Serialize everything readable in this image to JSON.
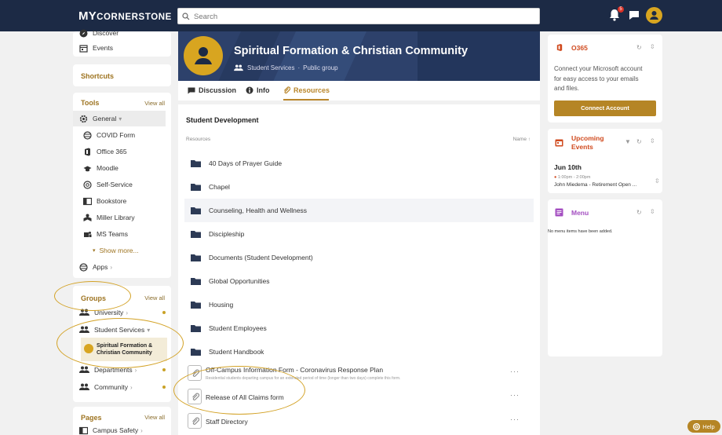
{
  "app": {
    "logo_prefix": "MY",
    "logo_main": "CORNERSTONE",
    "search_placeholder": "Search",
    "notification_count": "5"
  },
  "sidebar": {
    "discover": "Discover",
    "events": "Events",
    "shortcuts": "Shortcuts",
    "tools": {
      "title": "Tools",
      "view_all": "View all",
      "general": "General",
      "items": [
        "COVID Form",
        "Office 365",
        "Moodle",
        "Self-Service",
        "Bookstore",
        "Miller Library",
        "MS Teams"
      ],
      "show_more": "Show more...",
      "apps": "Apps"
    },
    "groups": {
      "title": "Groups",
      "view_all": "View all",
      "university": "University",
      "student_services": "Student Services",
      "active_group": [
        "Spiritual Formation &",
        "Christian Community"
      ],
      "departments": "Departments",
      "community": "Community"
    },
    "pages": {
      "title": "Pages",
      "view_all": "View all",
      "campus_safety": "Campus Safety"
    }
  },
  "group": {
    "title": "Spiritual Formation & Christian Community",
    "parent": "Student Services",
    "separator": "·",
    "visibility": "Public group"
  },
  "tabs": {
    "discussion": "Discussion",
    "info": "Info",
    "resources": "Resources"
  },
  "resources": {
    "section_title": "Student Development",
    "header_label": "Resources",
    "sort_label": "Name",
    "folders": [
      "40 Days of Prayer Guide",
      "Chapel",
      "Counseling, Health and Wellness",
      "Discipleship",
      "Documents (Student Development)",
      "Global Opportunities",
      "Housing",
      "Student Employees",
      "Student Handbook"
    ],
    "files": [
      {
        "name": "Off-Campus Information Form - Coronavirus Response Plan",
        "desc": "Residential students departing campus for an extended period of time (longer than two days) complete this form."
      },
      {
        "name": "Release of All Claims form",
        "desc": ""
      },
      {
        "name": "Staff Directory",
        "desc": ""
      }
    ],
    "more": "···"
  },
  "right": {
    "o365": {
      "title": "O365",
      "text": [
        "Connect your Microsoft account",
        "for easy access to your emails",
        "and files."
      ],
      "button": "Connect Account"
    },
    "events": {
      "title_1": "Upcoming",
      "title_2": "Events",
      "date": "Jun 10th",
      "time": "1:00pm - 2:00pm",
      "event": "John Miedema - Retirement Open ..."
    },
    "menu": {
      "title": "Menu",
      "empty": "No menu items have been added."
    }
  },
  "help": "Help",
  "colors": {
    "navy": "#1c2a45",
    "gold": "#b58525",
    "highlight_ellipse": "#d3a226",
    "accent_red": "#d04a1e"
  }
}
